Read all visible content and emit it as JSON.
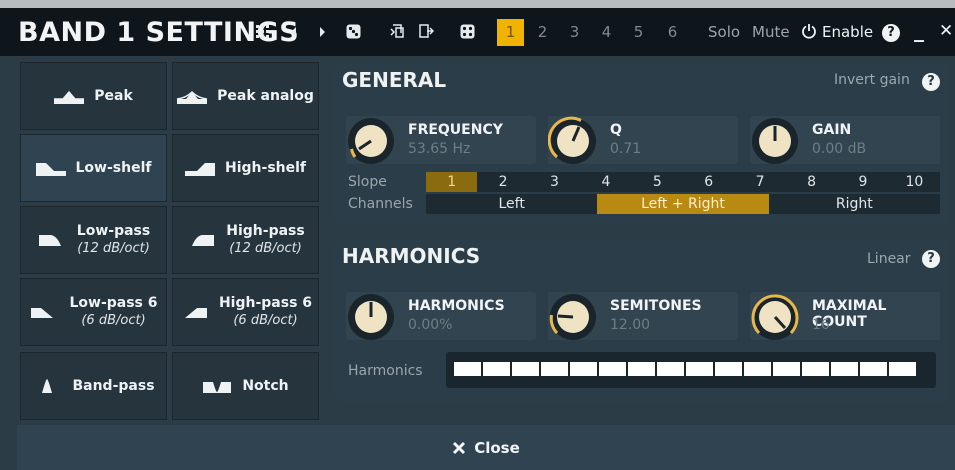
{
  "header": {
    "title": "BAND 1 SETTINGS",
    "tabs": [
      "1",
      "2",
      "3",
      "4",
      "5",
      "6"
    ],
    "active_tab": "1",
    "solo_label": "Solo",
    "mute_label": "Mute",
    "enable_label": "Enable",
    "help_label": "?",
    "minimize_label": "_",
    "close_label": "✕"
  },
  "filters": [
    {
      "label": "Peak",
      "sub": "",
      "icon": "peak-icon"
    },
    {
      "label": "Peak analog",
      "sub": "",
      "icon": "peak-analog-icon"
    },
    {
      "label": "Low-shelf",
      "sub": "",
      "icon": "low-shelf-icon"
    },
    {
      "label": "High-shelf",
      "sub": "",
      "icon": "high-shelf-icon"
    },
    {
      "label": "Low-pass",
      "sub": "(12 dB/oct)",
      "icon": "low-pass-icon"
    },
    {
      "label": "High-pass",
      "sub": "(12 dB/oct)",
      "icon": "high-pass-icon"
    },
    {
      "label": "Low-pass 6",
      "sub": "(6 dB/oct)",
      "icon": "low-pass-6-icon"
    },
    {
      "label": "High-pass 6",
      "sub": "(6 dB/oct)",
      "icon": "high-pass-6-icon"
    },
    {
      "label": "Band-pass",
      "sub": "",
      "icon": "band-pass-icon"
    },
    {
      "label": "Notch",
      "sub": "",
      "icon": "notch-icon"
    }
  ],
  "general": {
    "title": "GENERAL",
    "invert_label": "Invert gain",
    "frequency": {
      "name": "FREQUENCY",
      "value": "53.65 Hz"
    },
    "q": {
      "name": "Q",
      "value": "0.71"
    },
    "gain": {
      "name": "GAIN",
      "value": "0.00 dB"
    },
    "slope_label": "Slope",
    "slope_options": [
      "1",
      "2",
      "3",
      "4",
      "5",
      "6",
      "7",
      "8",
      "9",
      "10"
    ],
    "slope_selected": "1",
    "channels_label": "Channels",
    "channel_options": [
      "Left",
      "Left + Right",
      "Right"
    ],
    "channel_selected": "Left + Right"
  },
  "harmonics": {
    "title": "HARMONICS",
    "linear_label": "Linear",
    "harmonics": {
      "name": "HARMONICS",
      "value": "0.00%"
    },
    "semitones": {
      "name": "SEMITONES",
      "value": "12.00"
    },
    "maximal_count": {
      "name": "MAXIMAL COUNT",
      "value": "16"
    },
    "bar_label": "Harmonics",
    "bar_count": 16
  },
  "footer": {
    "close_label": "Close"
  },
  "colors": {
    "accent": "#f0b400",
    "slope_on": "#8a6b10",
    "channel_on": "#b98a12"
  }
}
